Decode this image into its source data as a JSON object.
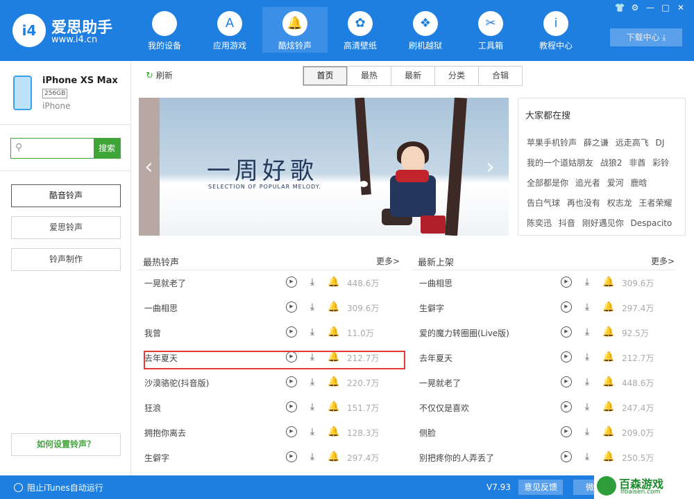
{
  "app": {
    "logo_mark": "i4",
    "name": "爱思助手",
    "url": "www.i4.cn",
    "accent_color": "#1e7fe0",
    "green_color": "#3ea636"
  },
  "nav": [
    {
      "label": "我的设备",
      "icon": "apple-icon",
      "glyph": ""
    },
    {
      "label": "应用游戏",
      "icon": "app-store-icon",
      "glyph": "A"
    },
    {
      "label": "酷炫铃声",
      "icon": "bell-icon",
      "glyph": "🔔",
      "active": true
    },
    {
      "label": "高清壁纸",
      "icon": "flower-icon",
      "glyph": "✿"
    },
    {
      "label": "刷机越狱",
      "icon": "dropbox-icon",
      "glyph": "❖"
    },
    {
      "label": "工具箱",
      "icon": "tools-icon",
      "glyph": "✂"
    },
    {
      "label": "教程中心",
      "icon": "info-icon",
      "glyph": "i"
    }
  ],
  "window_controls": [
    "👕",
    "⚙",
    "—",
    "□",
    "✕"
  ],
  "download_center": "下载中心 ⤓",
  "device": {
    "name": "iPhone XS Max",
    "capacity": "256GB",
    "model": "iPhone"
  },
  "search": {
    "placeholder": "",
    "button": "搜索"
  },
  "sidebar": {
    "items": [
      "酷音铃声",
      "爱思铃声",
      "铃声制作"
    ],
    "help": "如何设置铃声？"
  },
  "toolbar": {
    "refresh": "刷新"
  },
  "tabs": [
    "首页",
    "最热",
    "最新",
    "分类",
    "合辑"
  ],
  "banner": {
    "title": "一周好歌",
    "subtitle": "SELECTION OF POPULAR MELODY."
  },
  "hot_search": {
    "title": "大家都在搜",
    "tags": [
      "苹果手机铃声",
      "薛之谦",
      "远走高飞",
      "DJ",
      "我的一个道姑朋友",
      "战狼2",
      "非酋",
      "彩铃",
      "全部都是你",
      "追光者",
      "爱河",
      "鹿晗",
      "告白气球",
      "再也没有",
      "权志龙",
      "王者荣耀",
      "陈奕迅",
      "抖音",
      "刚好遇见你",
      "Despacito"
    ]
  },
  "hot_list": {
    "title": "最热铃声",
    "more": "更多>",
    "rows": [
      {
        "name": "一晃就老了",
        "plays": "448.6万"
      },
      {
        "name": "一曲相思",
        "plays": "309.6万"
      },
      {
        "name": "我曾",
        "plays": "11.0万"
      },
      {
        "name": "去年夏天",
        "plays": "212.7万"
      },
      {
        "name": "沙漠骆驼(抖音版)",
        "plays": "220.7万"
      },
      {
        "name": "狂浪",
        "plays": "151.7万"
      },
      {
        "name": "拥抱你离去",
        "plays": "128.3万"
      },
      {
        "name": "生僻字",
        "plays": "297.4万"
      }
    ]
  },
  "new_list": {
    "title": "最新上架",
    "more": "更多>",
    "rows": [
      {
        "name": "一曲相思",
        "plays": "309.6万"
      },
      {
        "name": "生僻字",
        "plays": "297.4万"
      },
      {
        "name": "爱的魔力转圈圈(Live版)",
        "plays": "92.5万"
      },
      {
        "name": "去年夏天",
        "plays": "212.7万"
      },
      {
        "name": "一晃就老了",
        "plays": "448.6万"
      },
      {
        "name": "不仅仅是喜欢",
        "plays": "247.4万"
      },
      {
        "name": "侧脸",
        "plays": "209.0万"
      },
      {
        "name": "别把疼你的人弄丢了",
        "plays": "250.5万"
      }
    ]
  },
  "status": {
    "itunes": "阻止iTunes自动运行",
    "version": "V7.93",
    "feedback": "意见反馈",
    "wechat": "微信"
  },
  "watermark": {
    "text": "百森游戏",
    "url": "lfbaisen.com"
  }
}
